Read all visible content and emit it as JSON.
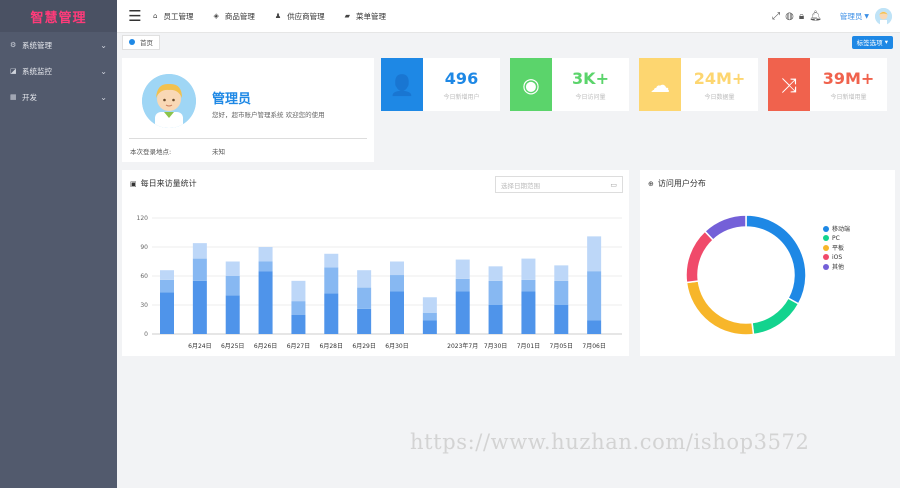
{
  "app": {
    "logo_text": "智慧管理"
  },
  "sidebar": {
    "items": [
      {
        "label": "系统管理",
        "icon": "gear-icon",
        "glyph": "⚙"
      },
      {
        "label": "系统监控",
        "icon": "monitor-icon",
        "glyph": "◪"
      },
      {
        "label": "开发",
        "icon": "grid-icon",
        "glyph": "▦"
      }
    ]
  },
  "topnav": {
    "links": [
      {
        "label": "员工管理",
        "glyph": "⌂"
      },
      {
        "label": "商品管理",
        "glyph": "◈"
      },
      {
        "label": "供应商管理",
        "glyph": "♟"
      },
      {
        "label": "菜单管理",
        "glyph": "▰"
      }
    ],
    "user_label": "管理员"
  },
  "tabs": {
    "home": "首页",
    "options_label": "标签选项"
  },
  "profile": {
    "name": "管理员",
    "greeting": "您好，超市账户管理系统 欢迎您的使用",
    "last_login_label": "本次登录地点:",
    "last_login_value": "未知"
  },
  "stats": [
    {
      "value": "496",
      "label": "今日新增用户",
      "color": "#1e88e5",
      "glyph": "👤",
      "icon": "add-user-icon"
    },
    {
      "value": "3K+",
      "label": "今日访问量",
      "color": "#5bd46b",
      "glyph": "◉",
      "icon": "eye-icon"
    },
    {
      "value": "24M+",
      "label": "今日数据量",
      "color": "#fdd670",
      "glyph": "☁",
      "icon": "cloud-upload-icon"
    },
    {
      "value": "39M+",
      "label": "今日新增用量",
      "color": "#f0624d",
      "glyph": "⤨",
      "icon": "shuffle-icon"
    }
  ],
  "bar_chart": {
    "title": "每日来访量统计",
    "date_placeholder": "选择日期范围"
  },
  "pie_chart": {
    "title": "访问用户分布"
  },
  "chart_data": [
    {
      "type": "bar",
      "title": "每日来访量统计",
      "categories": [
        "6月24日",
        "6月25日",
        "6月26日",
        "6月27日",
        "6月28日",
        "6月29日",
        "6月30日",
        "2023年7月",
        "7月30日",
        "7月01日",
        "7月05日",
        "7月06日"
      ],
      "series": [
        {
          "values": [
            43,
            55,
            40,
            65,
            20,
            42,
            26,
            44,
            14,
            44,
            30,
            44,
            30,
            14
          ]
        },
        {
          "values": [
            13,
            23,
            20,
            10,
            14,
            27,
            22,
            17,
            8,
            13,
            25,
            12,
            25,
            51
          ]
        },
        {
          "values": [
            10,
            16,
            15,
            15,
            21,
            14,
            18,
            14,
            16,
            20,
            15,
            22,
            16,
            36
          ]
        }
      ],
      "ylim": [
        0,
        120
      ],
      "yticks": [
        0,
        30,
        60,
        90,
        120
      ],
      "grid": true,
      "colors": [
        "#4f94ea",
        "#87b8f2",
        "#bdd7f8"
      ]
    },
    {
      "type": "pie",
      "title": "访问用户分布",
      "labels": [
        "移动端",
        "PC",
        "平板",
        "iOS",
        "其他"
      ],
      "values": [
        33,
        15,
        25,
        15,
        12
      ],
      "colors": [
        "#1e88e5",
        "#13d38e",
        "#f7b62a",
        "#f04a6a",
        "#7460d8"
      ],
      "legend_position": "right"
    }
  ],
  "watermark": "https://www.huzhan.com/ishop3572"
}
